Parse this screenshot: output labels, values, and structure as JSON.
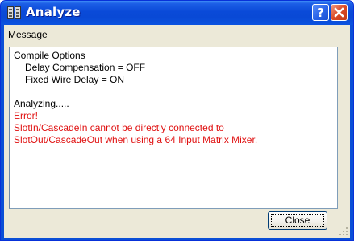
{
  "window": {
    "title": "Analyze",
    "title_icon": "analyze-app-icon",
    "help_button_icon": "question-mark-icon",
    "close_button_icon": "close-x-icon"
  },
  "content": {
    "section_label": "Message",
    "lines": {
      "compile_options": "Compile Options",
      "delay_compensation": "Delay Compensation = OFF",
      "fixed_wire_delay": "Fixed Wire Delay = ON",
      "analyzing": "Analyzing.....",
      "error": "Error!",
      "error_detail_1": "SlotIn/CascadeIn cannot be directly connected to",
      "error_detail_2": "SlotOut/CascadeOut when using a 64 Input Matrix Mixer."
    }
  },
  "footer": {
    "close_label": "Close"
  },
  "colors": {
    "titlebar": "#0a4ad8",
    "client_bg": "#ece9d8",
    "error_text": "#e01010"
  }
}
